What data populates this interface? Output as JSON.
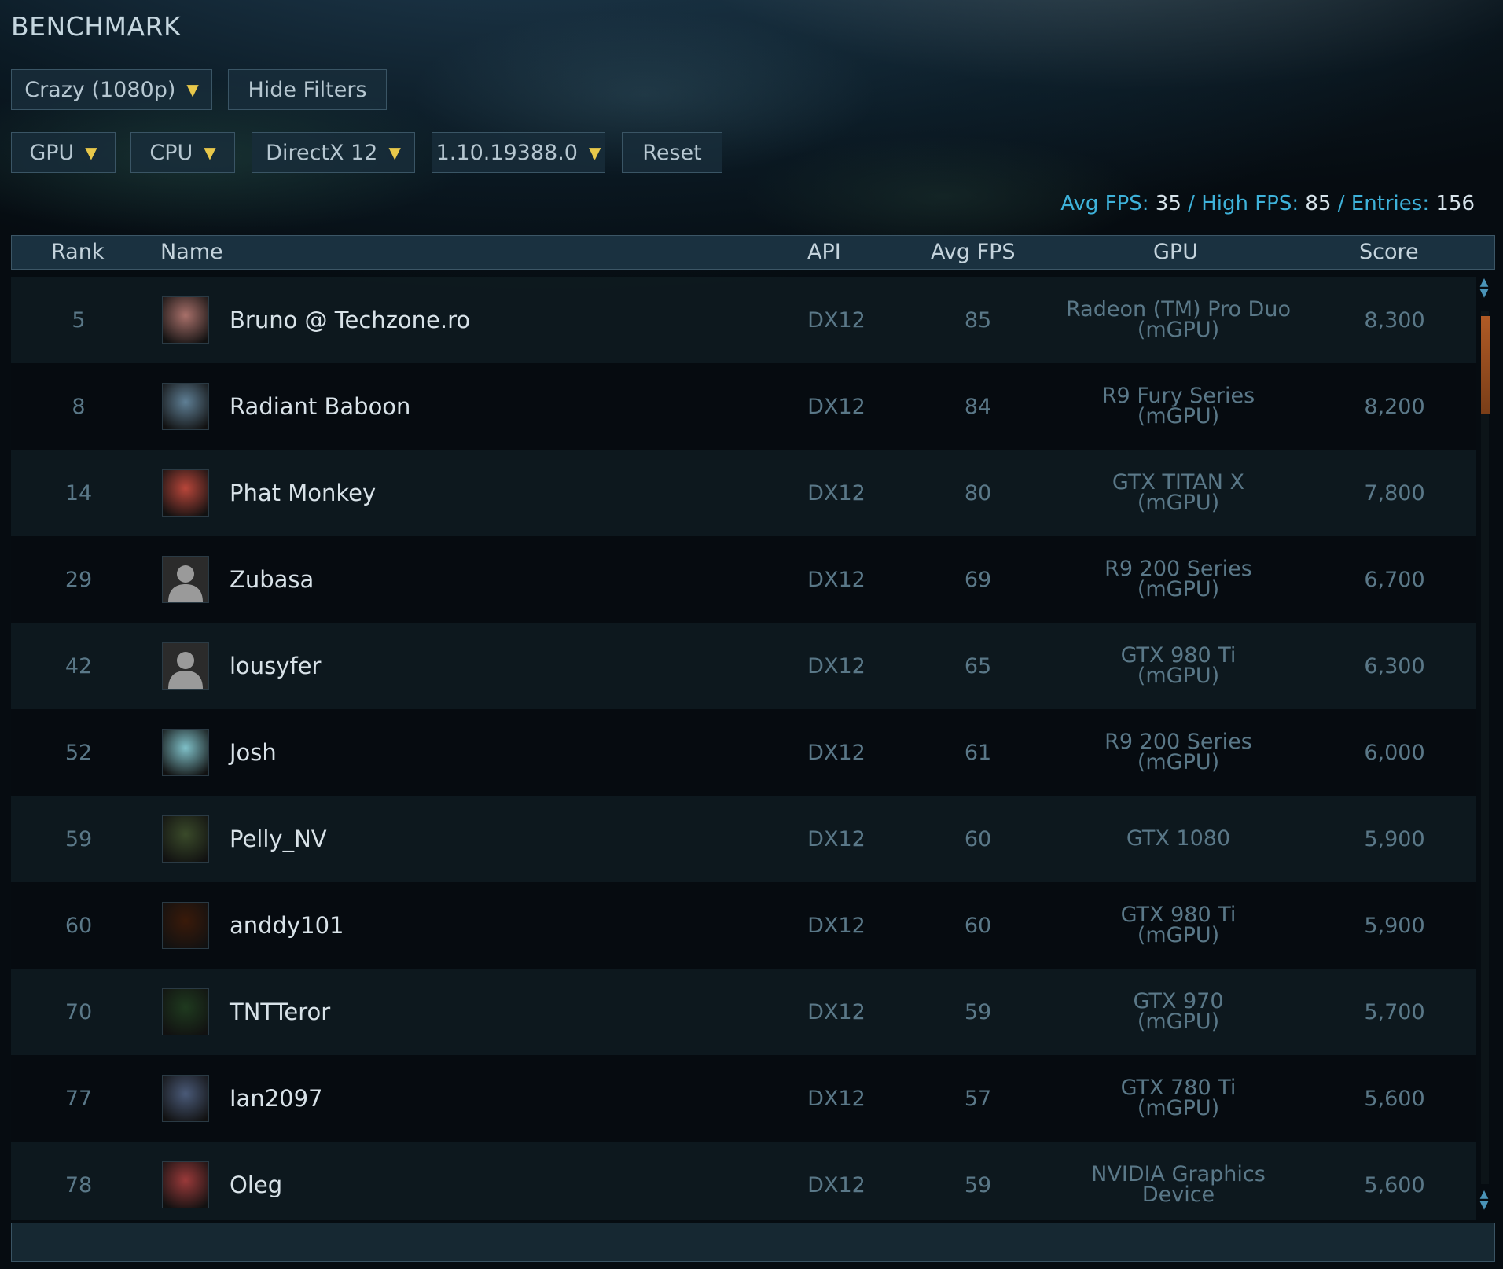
{
  "title": "BENCHMARK",
  "filters_row1": {
    "preset": {
      "label": "Crazy (1080p)",
      "icon": "caret-down-icon"
    },
    "hide_filters": "Hide Filters"
  },
  "filters_row2": {
    "gpu": "GPU",
    "cpu": "CPU",
    "api": "DirectX 12",
    "version": "1.10.19388.0",
    "reset": "Reset"
  },
  "stats": {
    "avg_label": "Avg FPS:",
    "avg_value": "35",
    "sep1": " / ",
    "high_label": "High FPS:",
    "high_value": "85",
    "sep2": " / ",
    "entries_label": "Entries:",
    "entries_value": "156"
  },
  "columns": {
    "rank": "Rank",
    "name": "Name",
    "api": "API",
    "fps": "Avg FPS",
    "gpu": "GPU",
    "score": "Score"
  },
  "rows": [
    {
      "rank": "5",
      "name": "Bruno @ Techzone.ro",
      "api": "DX12",
      "fps": "85",
      "gpu": "Radeon (TM) Pro Duo\n(mGPU)",
      "score": "8,300",
      "avatar": "skull-avatar",
      "avatar_color": "#a8706a"
    },
    {
      "rank": "8",
      "name": "Radiant Baboon",
      "api": "DX12",
      "fps": "84",
      "gpu": "R9 Fury Series\n(mGPU)",
      "score": "8,200",
      "avatar": "robot-avatar",
      "avatar_color": "#5f7f95"
    },
    {
      "rank": "14",
      "name": "Phat Monkey",
      "api": "DX12",
      "fps": "80",
      "gpu": "GTX TITAN X\n(mGPU)",
      "score": "7,800",
      "avatar": "photo-avatar",
      "avatar_color": "#b8463a"
    },
    {
      "rank": "29",
      "name": "Zubasa",
      "api": "DX12",
      "fps": "69",
      "gpu": "R9 200 Series\n(mGPU)",
      "score": "6,700",
      "avatar": "default-user-avatar",
      "avatar_color": "#2e2e2e"
    },
    {
      "rank": "42",
      "name": "lousyfer",
      "api": "DX12",
      "fps": "65",
      "gpu": "GTX 980 Ti\n(mGPU)",
      "score": "6,300",
      "avatar": "default-user-avatar",
      "avatar_color": "#2e2e2e"
    },
    {
      "rank": "52",
      "name": "Josh",
      "api": "DX12",
      "fps": "61",
      "gpu": "R9 200 Series\n(mGPU)",
      "score": "6,000",
      "avatar": "photo-avatar",
      "avatar_color": "#7fc0c8"
    },
    {
      "rank": "59",
      "name": "Pelly_NV",
      "api": "DX12",
      "fps": "60",
      "gpu": "GTX 1080",
      "score": "5,900",
      "avatar": "geforce-avatar",
      "avatar_color": "#3a4a2a"
    },
    {
      "rank": "60",
      "name": "anddy101",
      "api": "DX12",
      "fps": "60",
      "gpu": "GTX 980 Ti\n(mGPU)",
      "score": "5,900",
      "avatar": "fire-avatar",
      "avatar_color": "#3a1a0a"
    },
    {
      "rank": "70",
      "name": "TNTTeror",
      "api": "DX12",
      "fps": "59",
      "gpu": "GTX 970\n(mGPU)",
      "score": "5,700",
      "avatar": "matrix-avatar",
      "avatar_color": "#1f3a1f"
    },
    {
      "rank": "77",
      "name": "Ian2097",
      "api": "DX12",
      "fps": "57",
      "gpu": "GTX 780 Ti\n(mGPU)",
      "score": "5,600",
      "avatar": "photo-avatar",
      "avatar_color": "#4a5a78"
    },
    {
      "rank": "78",
      "name": "Oleg",
      "api": "DX12",
      "fps": "59",
      "gpu": "NVIDIA Graphics\nDevice",
      "score": "5,600",
      "avatar": "photo-avatar",
      "avatar_color": "#9a3a3a"
    }
  ],
  "colors": {
    "accent_stat_label": "#3eb2da",
    "caret": "#e8c84a",
    "scroll_thumb": "#b05a25"
  }
}
